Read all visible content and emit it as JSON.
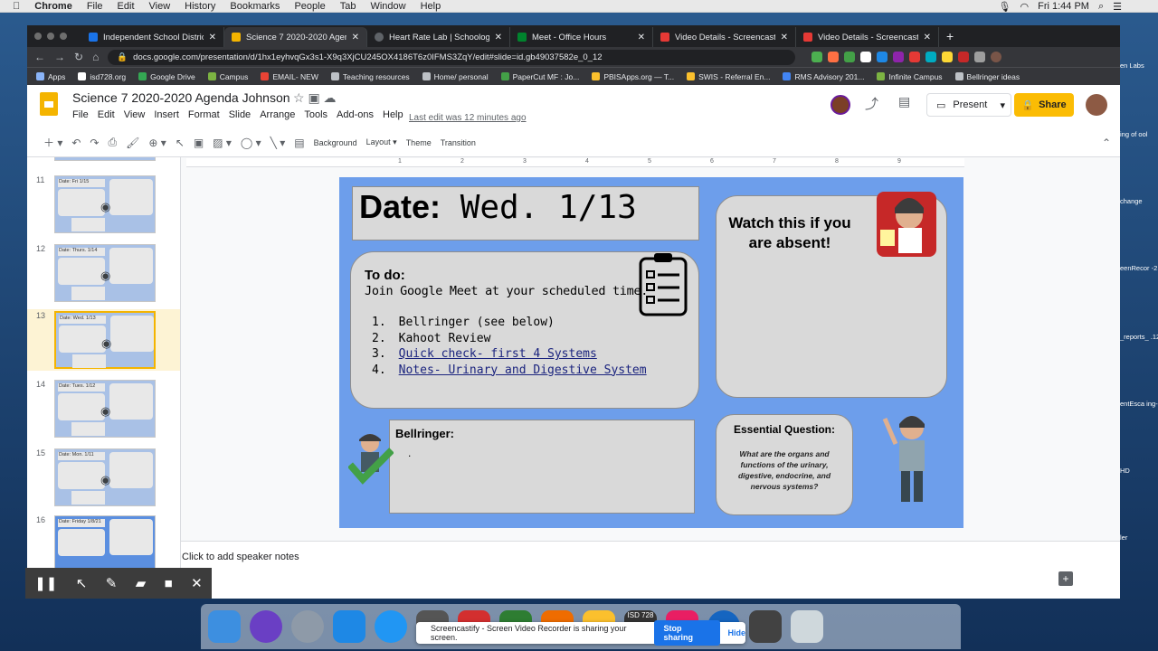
{
  "mac_menu": {
    "apple": "",
    "items": [
      "Chrome",
      "File",
      "Edit",
      "View",
      "History",
      "Bookmarks",
      "People",
      "Tab",
      "Window",
      "Help"
    ],
    "clock": "Fri 1:44 PM"
  },
  "browser": {
    "tabs": [
      {
        "label": "Independent School District 72",
        "color": "#1a73e8"
      },
      {
        "label": "Science 7 2020-2020 Agenda",
        "color": "#f4b400"
      },
      {
        "label": "Heart Rate Lab | Schoology",
        "color": "#5f6368"
      },
      {
        "label": "Meet - Office Hours",
        "color": "#00832d"
      },
      {
        "label": "Video Details - Screencastify",
        "color": "#e53935"
      },
      {
        "label": "Video Details - Screencastify",
        "color": "#e53935"
      }
    ],
    "new_tab": "+",
    "url": "docs.google.com/presentation/d/1hx1eyhvqGx3s1-X9q3XjCU245OX4186T6z0IFMS3ZqY/edit#slide=id.gb49037582e_0_12",
    "bookmarks": [
      "Apps",
      "isd728.org",
      "Google Drive",
      "Campus",
      "EMAIL- NEW",
      "Teaching resources",
      "Home/ personal",
      "PaperCut MF : Jo...",
      "PBISApps.org — T...",
      "SWIS - Referral En...",
      "RMS Advisory 201...",
      "Infinite Campus",
      "Bellringer ideas"
    ],
    "bm_more": "»"
  },
  "slides_app": {
    "title": "Science 7 2020-2020 Agenda Johnson",
    "menus": [
      "File",
      "Edit",
      "View",
      "Insert",
      "Format",
      "Slide",
      "Arrange",
      "Tools",
      "Add-ons",
      "Help"
    ],
    "last_edit": "Last edit was 12 minutes ago",
    "present_label": "Present",
    "share_label": "Share",
    "toolbar": {
      "background": "Background",
      "layout": "Layout ▾",
      "theme": "Theme",
      "transition": "Transition"
    },
    "ruler_ticks": [
      "1",
      "2",
      "3",
      "4",
      "5",
      "6",
      "7",
      "8",
      "9"
    ],
    "thumbnails": [
      {
        "num": "11",
        "label": "Date: Fri 1/15"
      },
      {
        "num": "12",
        "label": "Date: Thurs. 1/14"
      },
      {
        "num": "13",
        "label": "Date: Wed. 1/13"
      },
      {
        "num": "14",
        "label": "Date: Tues. 1/12"
      },
      {
        "num": "15",
        "label": "Date: Mon. 1/11"
      },
      {
        "num": "16",
        "label": "Date: Friday 1/8/21"
      }
    ],
    "speaker_notes_placeholder": "Click to add speaker notes"
  },
  "slide": {
    "date_label": "Date:",
    "date_value": " Wed. 1/13",
    "todo_title": "To do:",
    "todo_line": "Join Google Meet at your scheduled time.",
    "todo_items": [
      {
        "n": "1.",
        "text": "Bellringer (see below)",
        "link": false
      },
      {
        "n": "2.",
        "text": "Kahoot Review",
        "link": false
      },
      {
        "n": "3.",
        "text": "Quick check- first 4 Systems",
        "link": true
      },
      {
        "n": "4.",
        "text": "Notes- Urinary and Digestive System",
        "link": true
      }
    ],
    "watch_title": "Watch this if you are absent!",
    "bellringer_title": "Bellringer:",
    "bellringer_body": ".",
    "eq_title": "Essential Question:",
    "eq_text": "What are the organs and functions of the urinary, digestive, endocrine, and nervous systems?"
  },
  "share_notice": {
    "text": "Screencastify - Screen Video Recorder is sharing your screen.",
    "stop": "Stop sharing",
    "hide": "Hide"
  },
  "desktop_labels": [
    "en Labs",
    "ing of ool",
    "change",
    "eenRecor -2.0.dmg",
    "_reports_ .122.pdf",
    "entEsca ing-1.zip",
    "HD",
    "ler"
  ],
  "dock_badge": "ISD 728 jamf"
}
